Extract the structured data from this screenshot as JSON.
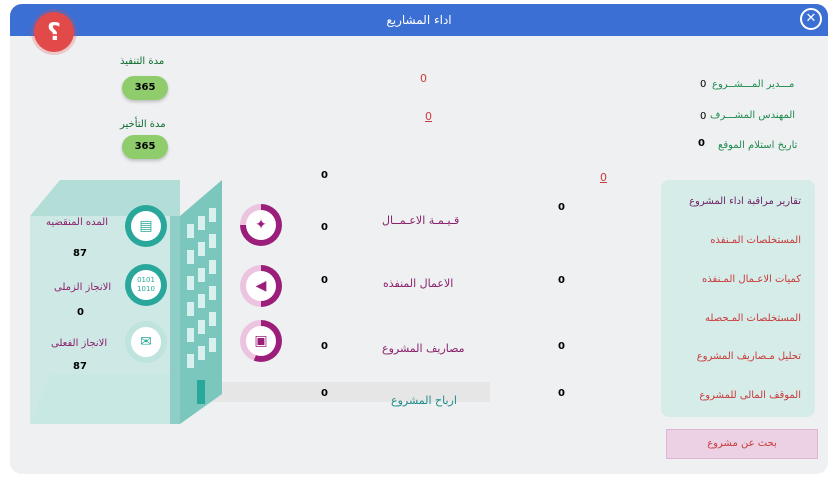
{
  "window": {
    "title": "اداء المشاريع",
    "close_glyph": "✕",
    "help_glyph": "؟"
  },
  "colors": {
    "titlebar": "#3b6fd4",
    "teal": "#2aa79b",
    "magenta": "#9b1f7a",
    "pill_green": "#8fcc6b"
  },
  "info": {
    "manager_label": "مـــدير المـــشــروع",
    "manager_value": "0",
    "engineer_label": "المهندس المشـــرف",
    "engineer_value": "0",
    "site_label": "تاريخ استلام الموقع",
    "site_value": "0"
  },
  "durations": {
    "exec_label": "مدة التنفيذ",
    "exec_value": "365",
    "delay_label": "مدة التأخير",
    "delay_value": "365"
  },
  "red_values": {
    "a": "0",
    "b": "0",
    "c": "0"
  },
  "building": {
    "elapsed_label": "المده المنقضيه",
    "elapsed_value": "87",
    "time_label": "الانجاز الزملى",
    "time_value": "0",
    "actual_label": "الانجاز الفعلى",
    "actual_value": "87"
  },
  "metrics": {
    "top_value": "0",
    "work_value_label": "قـيـمـة الاعـمــال",
    "work_value_left": "0",
    "work_value_right": "0",
    "executed_label": "الاعمال المنفذه",
    "executed_left": "0",
    "executed_right": "0",
    "expenses_label": "مصاريف المشروع",
    "expenses_left": "0",
    "expenses_right": "0",
    "profit_label": "ارباح المشروع",
    "profit_left": "0",
    "profit_right": "0"
  },
  "reports": {
    "title": "تقارير مراقبة اداء المشروع",
    "items": [
      "المستخلصات المـنفذه",
      "كميات الاعـمال المـنفذه",
      "المستخلصات المـحصله",
      "تحليل مـصاريف المشروع",
      "الموقف المالى للمشروع"
    ]
  },
  "search_button": "بحث عن مشروع",
  "icons": {
    "help": "help-icon",
    "close": "close-icon",
    "document": "document-icon",
    "binary": "binary-icon",
    "mail": "mail-icon",
    "twitter": "twitter-icon",
    "speaker": "speaker-icon",
    "film": "film-icon"
  }
}
